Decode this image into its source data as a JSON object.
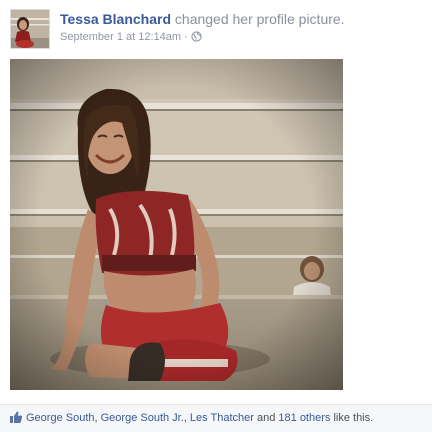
{
  "post": {
    "author": "Tessa Blanchard",
    "action": " changed her profile picture.",
    "timestamp": "September 1 at 12:14am",
    "separator": " · ",
    "privacy_icon": "globe-icon",
    "avatar_icon": "profile-thumbnail",
    "photo": "profile-photo"
  },
  "likes": {
    "icon": "thumbs-up-icon",
    "names": [
      "George South",
      "George South Jr.",
      "Les Thatcher"
    ],
    "comma": ", ",
    "and_text": " and ",
    "others_link": "181 others",
    "suffix": " like this."
  },
  "colors": {
    "link": "#3b5998",
    "meta": "#9197a3",
    "likes_bar_bg": "#f6f7f9"
  }
}
